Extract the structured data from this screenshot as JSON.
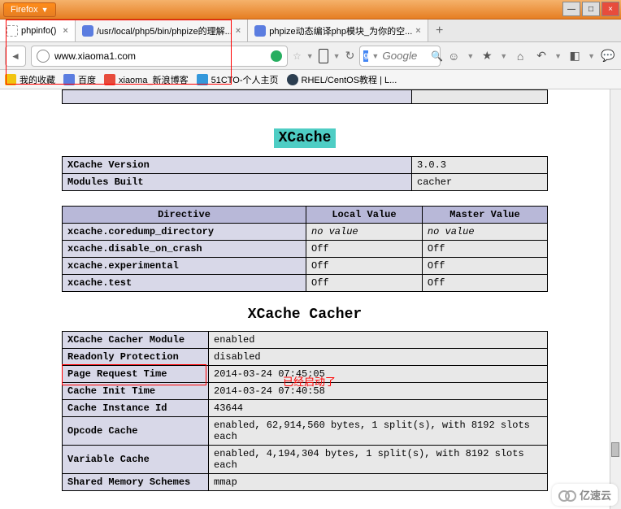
{
  "browser": {
    "name": "Firefox"
  },
  "window": {
    "min": "—",
    "max": "□",
    "close": "×"
  },
  "tabs": [
    {
      "title": "phpinfo()",
      "active": true
    },
    {
      "title": "/usr/local/php5/bin/phpize的理解..."
    },
    {
      "title": "phpize动态编译php模块_为你的空..."
    }
  ],
  "url": "www.xiaoma1.com",
  "search_placeholder": "Google",
  "bookmarks": [
    {
      "label": "我的收藏"
    },
    {
      "label": "百度"
    },
    {
      "label": "xiaoma_新浪博客"
    },
    {
      "label": "51CTO-个人主页"
    },
    {
      "label": "RHEL/CentOS教程 | L..."
    }
  ],
  "section1_title": "XCache",
  "tbl1": [
    {
      "k": "XCache Version",
      "v": "3.0.3"
    },
    {
      "k": "Modules Built",
      "v": "cacher"
    }
  ],
  "tbl2_head": {
    "c1": "Directive",
    "c2": "Local Value",
    "c3": "Master Value"
  },
  "tbl2": [
    {
      "d": "xcache.coredump_directory",
      "l": "no value",
      "m": "no value",
      "nv": true
    },
    {
      "d": "xcache.disable_on_crash",
      "l": "Off",
      "m": "Off"
    },
    {
      "d": "xcache.experimental",
      "l": "Off",
      "m": "Off"
    },
    {
      "d": "xcache.test",
      "l": "Off",
      "m": "Off"
    }
  ],
  "section2_title": "XCache Cacher",
  "tbl3": [
    {
      "k": "XCache Cacher Module",
      "v": "enabled"
    },
    {
      "k": "Readonly Protection",
      "v": "disabled"
    },
    {
      "k": "Page Request Time",
      "v": "2014-03-24 07:45:05"
    },
    {
      "k": "Cache Init Time",
      "v": "2014-03-24 07:40:58"
    },
    {
      "k": "Cache Instance Id",
      "v": "43644"
    },
    {
      "k": "Opcode Cache",
      "v": "enabled, 62,914,560 bytes, 1 split(s), with 8192 slots each"
    },
    {
      "k": "Variable Cache",
      "v": "enabled, 4,194,304 bytes, 1 split(s), with 8192 slots each"
    },
    {
      "k": "Shared Memory Schemes",
      "v": "mmap"
    }
  ],
  "annotation": "已经启动了",
  "watermark": "亿速云"
}
